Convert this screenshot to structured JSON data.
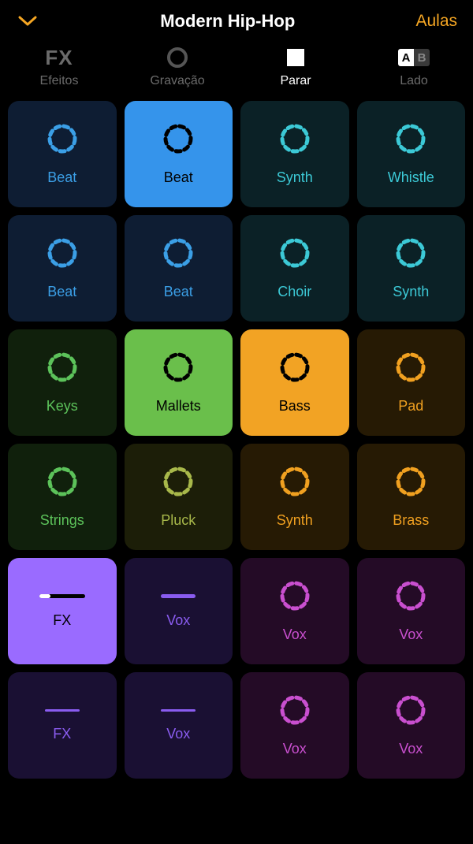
{
  "header": {
    "title": "Modern Hip-Hop",
    "lessons": "Aulas"
  },
  "toolbar": {
    "fx": {
      "icon": "FX",
      "label": "Efeitos"
    },
    "rec": {
      "label": "Gravação"
    },
    "stop": {
      "label": "Parar"
    },
    "side": {
      "a": "A",
      "b": "B",
      "label": "Lado"
    }
  },
  "colors": {
    "amber": "#f5a623",
    "blue": "#3b9fe6",
    "blueBright": "#3594eb",
    "teal": "#3cc9d6",
    "green": "#5cc25a",
    "greenBright": "#6abf4b",
    "orange": "#f0a020",
    "orangeBright": "#f2a324",
    "purple": "#8a5cf0",
    "purpleBright": "#9a6bff",
    "magenta": "#c94fcf"
  },
  "pads": [
    [
      {
        "label": "Beat",
        "type": "ring",
        "color": "#3b9fe6",
        "bg": "#0e1d33",
        "txt": "#3b9fe6"
      },
      {
        "label": "Beat",
        "type": "ring",
        "color": "#000",
        "bg": "#3594eb",
        "txt": "#000"
      },
      {
        "label": "Synth",
        "type": "ring",
        "color": "#3cc9d6",
        "bg": "#0b2126",
        "txt": "#3cc9d6"
      },
      {
        "label": "Whistle",
        "type": "ring",
        "color": "#3cc9d6",
        "bg": "#0b2126",
        "txt": "#3cc9d6"
      }
    ],
    [
      {
        "label": "Beat",
        "type": "ring",
        "color": "#3b9fe6",
        "bg": "#0e1d33",
        "txt": "#3b9fe6"
      },
      {
        "label": "Beat",
        "type": "ring",
        "color": "#3b9fe6",
        "bg": "#0e1d33",
        "txt": "#3b9fe6"
      },
      {
        "label": "Choir",
        "type": "ring",
        "color": "#3cc9d6",
        "bg": "#0b2126",
        "txt": "#3cc9d6"
      },
      {
        "label": "Synth",
        "type": "ring",
        "color": "#3cc9d6",
        "bg": "#0b2126",
        "txt": "#3cc9d6"
      }
    ],
    [
      {
        "label": "Keys",
        "type": "ring",
        "color": "#5cc25a",
        "bg": "#10200c",
        "txt": "#5cc25a"
      },
      {
        "label": "Mallets",
        "type": "ring",
        "color": "#000",
        "bg": "#6abf4b",
        "txt": "#000"
      },
      {
        "label": "Bass",
        "type": "ring",
        "color": "#000",
        "bg": "#f2a324",
        "txt": "#000"
      },
      {
        "label": "Pad",
        "type": "ring",
        "color": "#f0a020",
        "bg": "#261a04",
        "txt": "#f0a020"
      }
    ],
    [
      {
        "label": "Strings",
        "type": "ring",
        "color": "#5cc25a",
        "bg": "#10200c",
        "txt": "#5cc25a"
      },
      {
        "label": "Pluck",
        "type": "ring",
        "color": "#a8b84a",
        "bg": "#1c1e08",
        "txt": "#a8b84a"
      },
      {
        "label": "Synth",
        "type": "ring",
        "color": "#f0a020",
        "bg": "#261a04",
        "txt": "#f0a020"
      },
      {
        "label": "Brass",
        "type": "ring",
        "color": "#f0a020",
        "bg": "#261a04",
        "txt": "#f0a020"
      }
    ],
    [
      {
        "label": "FX",
        "type": "progress",
        "color": "#fff",
        "bg": "#9a6bff",
        "txt": "#000",
        "progress": 0.25
      },
      {
        "label": "Vox",
        "type": "line",
        "color": "#8a5cf0",
        "bg": "#1a1033",
        "txt": "#8a5cf0"
      },
      {
        "label": "Vox",
        "type": "ring",
        "color": "#c94fcf",
        "bg": "#240b26",
        "txt": "#c94fcf"
      },
      {
        "label": "Vox",
        "type": "ring",
        "color": "#c94fcf",
        "bg": "#240b26",
        "txt": "#c94fcf"
      }
    ],
    [
      {
        "label": "FX",
        "type": "line-thin",
        "color": "#8a5cf0",
        "bg": "#1a1033",
        "txt": "#8a5cf0"
      },
      {
        "label": "Vox",
        "type": "line-thin",
        "color": "#8a5cf0",
        "bg": "#1a1033",
        "txt": "#8a5cf0"
      },
      {
        "label": "Vox",
        "type": "ring",
        "color": "#c94fcf",
        "bg": "#240b26",
        "txt": "#c94fcf"
      },
      {
        "label": "Vox",
        "type": "ring",
        "color": "#c94fcf",
        "bg": "#240b26",
        "txt": "#c94fcf"
      }
    ]
  ]
}
